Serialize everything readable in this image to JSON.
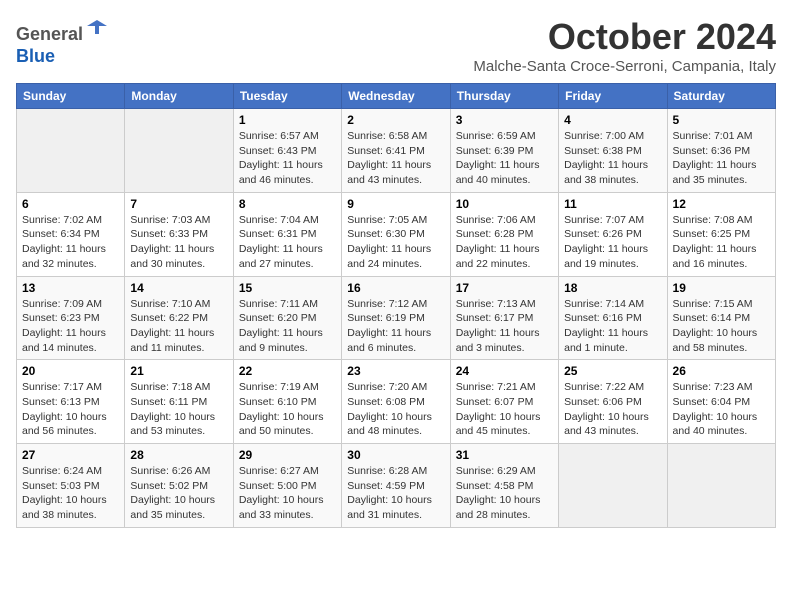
{
  "header": {
    "logo_line1": "General",
    "logo_line2": "Blue",
    "month_title": "October 2024",
    "subtitle": "Malche-Santa Croce-Serroni, Campania, Italy"
  },
  "days_of_week": [
    "Sunday",
    "Monday",
    "Tuesday",
    "Wednesday",
    "Thursday",
    "Friday",
    "Saturday"
  ],
  "weeks": [
    [
      {
        "day": "",
        "info": ""
      },
      {
        "day": "",
        "info": ""
      },
      {
        "day": "1",
        "info": "Sunrise: 6:57 AM\nSunset: 6:43 PM\nDaylight: 11 hours and 46 minutes."
      },
      {
        "day": "2",
        "info": "Sunrise: 6:58 AM\nSunset: 6:41 PM\nDaylight: 11 hours and 43 minutes."
      },
      {
        "day": "3",
        "info": "Sunrise: 6:59 AM\nSunset: 6:39 PM\nDaylight: 11 hours and 40 minutes."
      },
      {
        "day": "4",
        "info": "Sunrise: 7:00 AM\nSunset: 6:38 PM\nDaylight: 11 hours and 38 minutes."
      },
      {
        "day": "5",
        "info": "Sunrise: 7:01 AM\nSunset: 6:36 PM\nDaylight: 11 hours and 35 minutes."
      }
    ],
    [
      {
        "day": "6",
        "info": "Sunrise: 7:02 AM\nSunset: 6:34 PM\nDaylight: 11 hours and 32 minutes."
      },
      {
        "day": "7",
        "info": "Sunrise: 7:03 AM\nSunset: 6:33 PM\nDaylight: 11 hours and 30 minutes."
      },
      {
        "day": "8",
        "info": "Sunrise: 7:04 AM\nSunset: 6:31 PM\nDaylight: 11 hours and 27 minutes."
      },
      {
        "day": "9",
        "info": "Sunrise: 7:05 AM\nSunset: 6:30 PM\nDaylight: 11 hours and 24 minutes."
      },
      {
        "day": "10",
        "info": "Sunrise: 7:06 AM\nSunset: 6:28 PM\nDaylight: 11 hours and 22 minutes."
      },
      {
        "day": "11",
        "info": "Sunrise: 7:07 AM\nSunset: 6:26 PM\nDaylight: 11 hours and 19 minutes."
      },
      {
        "day": "12",
        "info": "Sunrise: 7:08 AM\nSunset: 6:25 PM\nDaylight: 11 hours and 16 minutes."
      }
    ],
    [
      {
        "day": "13",
        "info": "Sunrise: 7:09 AM\nSunset: 6:23 PM\nDaylight: 11 hours and 14 minutes."
      },
      {
        "day": "14",
        "info": "Sunrise: 7:10 AM\nSunset: 6:22 PM\nDaylight: 11 hours and 11 minutes."
      },
      {
        "day": "15",
        "info": "Sunrise: 7:11 AM\nSunset: 6:20 PM\nDaylight: 11 hours and 9 minutes."
      },
      {
        "day": "16",
        "info": "Sunrise: 7:12 AM\nSunset: 6:19 PM\nDaylight: 11 hours and 6 minutes."
      },
      {
        "day": "17",
        "info": "Sunrise: 7:13 AM\nSunset: 6:17 PM\nDaylight: 11 hours and 3 minutes."
      },
      {
        "day": "18",
        "info": "Sunrise: 7:14 AM\nSunset: 6:16 PM\nDaylight: 11 hours and 1 minute."
      },
      {
        "day": "19",
        "info": "Sunrise: 7:15 AM\nSunset: 6:14 PM\nDaylight: 10 hours and 58 minutes."
      }
    ],
    [
      {
        "day": "20",
        "info": "Sunrise: 7:17 AM\nSunset: 6:13 PM\nDaylight: 10 hours and 56 minutes."
      },
      {
        "day": "21",
        "info": "Sunrise: 7:18 AM\nSunset: 6:11 PM\nDaylight: 10 hours and 53 minutes."
      },
      {
        "day": "22",
        "info": "Sunrise: 7:19 AM\nSunset: 6:10 PM\nDaylight: 10 hours and 50 minutes."
      },
      {
        "day": "23",
        "info": "Sunrise: 7:20 AM\nSunset: 6:08 PM\nDaylight: 10 hours and 48 minutes."
      },
      {
        "day": "24",
        "info": "Sunrise: 7:21 AM\nSunset: 6:07 PM\nDaylight: 10 hours and 45 minutes."
      },
      {
        "day": "25",
        "info": "Sunrise: 7:22 AM\nSunset: 6:06 PM\nDaylight: 10 hours and 43 minutes."
      },
      {
        "day": "26",
        "info": "Sunrise: 7:23 AM\nSunset: 6:04 PM\nDaylight: 10 hours and 40 minutes."
      }
    ],
    [
      {
        "day": "27",
        "info": "Sunrise: 6:24 AM\nSunset: 5:03 PM\nDaylight: 10 hours and 38 minutes."
      },
      {
        "day": "28",
        "info": "Sunrise: 6:26 AM\nSunset: 5:02 PM\nDaylight: 10 hours and 35 minutes."
      },
      {
        "day": "29",
        "info": "Sunrise: 6:27 AM\nSunset: 5:00 PM\nDaylight: 10 hours and 33 minutes."
      },
      {
        "day": "30",
        "info": "Sunrise: 6:28 AM\nSunset: 4:59 PM\nDaylight: 10 hours and 31 minutes."
      },
      {
        "day": "31",
        "info": "Sunrise: 6:29 AM\nSunset: 4:58 PM\nDaylight: 10 hours and 28 minutes."
      },
      {
        "day": "",
        "info": ""
      },
      {
        "day": "",
        "info": ""
      }
    ]
  ]
}
